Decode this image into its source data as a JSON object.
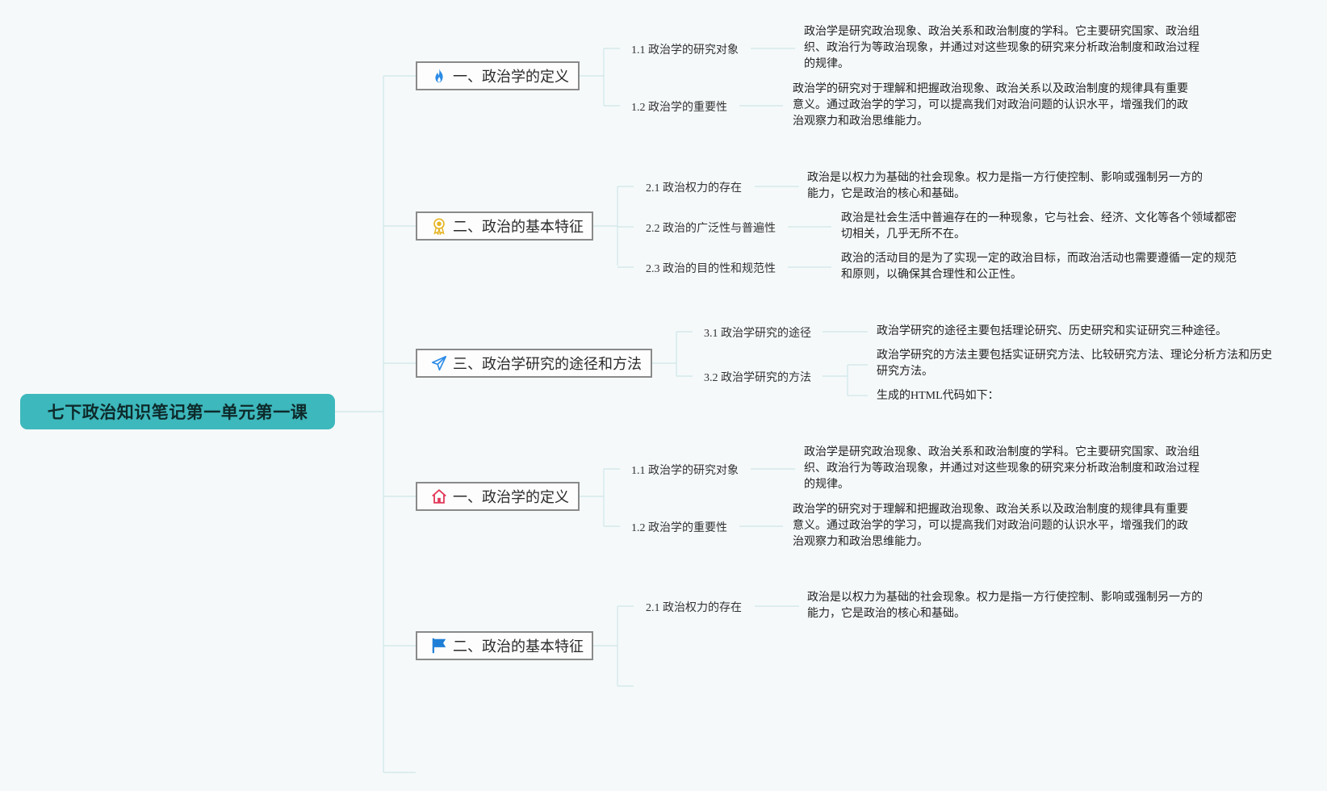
{
  "root": {
    "title": "七下政治知识笔记第一单元第一课"
  },
  "topics": [
    {
      "label": "一、政治学的定义",
      "icon": "flame-icon",
      "icon_color": "#2b8be6",
      "subs": [
        {
          "label": "1.1 政治学的研究对象",
          "desc": "政治学是研究政治现象、政治关系和政治制度的学科。它主要研究国家、政治组织、政治行为等政治现象，并通过对这些现象的研究来分析政治制度和政治过程的规律。"
        },
        {
          "label": "1.2 政治学的重要性",
          "desc": "政治学的研究对于理解和把握政治现象、政治关系以及政治制度的规律具有重要意义。通过政治学的学习，可以提高我们对政治问题的认识水平，增强我们的政治观察力和政治思维能力。"
        }
      ]
    },
    {
      "label": "二、政治的基本特征",
      "icon": "medal-icon",
      "icon_color": "#e6b422",
      "subs": [
        {
          "label": "2.1 政治权力的存在",
          "desc": "政治是以权力为基础的社会现象。权力是指一方行使控制、影响或强制另一方的能力，它是政治的核心和基础。"
        },
        {
          "label": "2.2 政治的广泛性与普遍性",
          "desc": "政治是社会生活中普遍存在的一种现象，它与社会、经济、文化等各个领域都密切相关，几乎无所不在。"
        },
        {
          "label": "2.3 政治的目的性和规范性",
          "desc": "政治的活动目的是为了实现一定的政治目标，而政治活动也需要遵循一定的规范和原则，以确保其合理性和公正性。"
        }
      ]
    },
    {
      "label": "三、政治学研究的途径和方法",
      "icon": "paper-plane-icon",
      "icon_color": "#2b8be6",
      "subs": [
        {
          "label": "3.1 政治学研究的途径",
          "desc": "政治学研究的途径主要包括理论研究、历史研究和实证研究三种途径。"
        },
        {
          "label": "3.2 政治学研究的方法",
          "descs": [
            "政治学研究的方法主要包括实证研究方法、比较研究方法、理论分析方法和历史研究方法。",
            "生成的HTML代码如下："
          ]
        }
      ]
    },
    {
      "label": "一、政治学的定义",
      "icon": "home-icon",
      "icon_color": "#e23a5a",
      "subs": [
        {
          "label": "1.1 政治学的研究对象",
          "desc": "政治学是研究政治现象、政治关系和政治制度的学科。它主要研究国家、政治组织、政治行为等政治现象，并通过对这些现象的研究来分析政治制度和政治过程的规律。"
        },
        {
          "label": "1.2 政治学的重要性",
          "desc": "政治学的研究对于理解和把握政治现象、政治关系以及政治制度的规律具有重要意义。通过政治学的学习，可以提高我们对政治问题的认识水平，增强我们的政治观察力和政治思维能力。"
        }
      ]
    },
    {
      "label": "二、政治的基本特征",
      "icon": "flag-icon",
      "icon_color": "#1f7fd6",
      "subs": [
        {
          "label": "2.1 政治权力的存在",
          "desc": "政治是以权力为基础的社会现象。权力是指一方行使控制、影响或强制另一方的能力，它是政治的核心和基础。"
        }
      ]
    }
  ]
}
